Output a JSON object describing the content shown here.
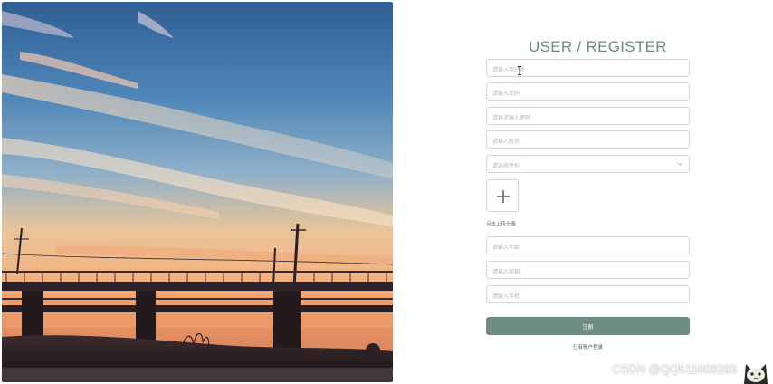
{
  "form": {
    "title": "USER / REGISTER",
    "fields": {
      "username": {
        "placeholder": "请输入用户名"
      },
      "password": {
        "placeholder": "请输入密码"
      },
      "password_confirm": {
        "placeholder": "请再次输入密码"
      },
      "name": {
        "placeholder": "请输入姓名"
      },
      "gender": {
        "placeholder": "请选择性别"
      },
      "age": {
        "placeholder": "请输入年龄"
      },
      "email": {
        "placeholder": "请输入邮箱"
      },
      "phone": {
        "placeholder": "请输入手机"
      }
    },
    "upload_tip": "点击上传头像",
    "submit_label": "注册",
    "login_link": "已有账户登录"
  },
  "watermark": "CSDN @QQ511008285",
  "colors": {
    "accent": "#6f8d82",
    "title": "#6b8a7e",
    "border": "#cfd6d3"
  },
  "icons": {
    "upload": "plus-icon",
    "select": "chevron-down-icon"
  }
}
